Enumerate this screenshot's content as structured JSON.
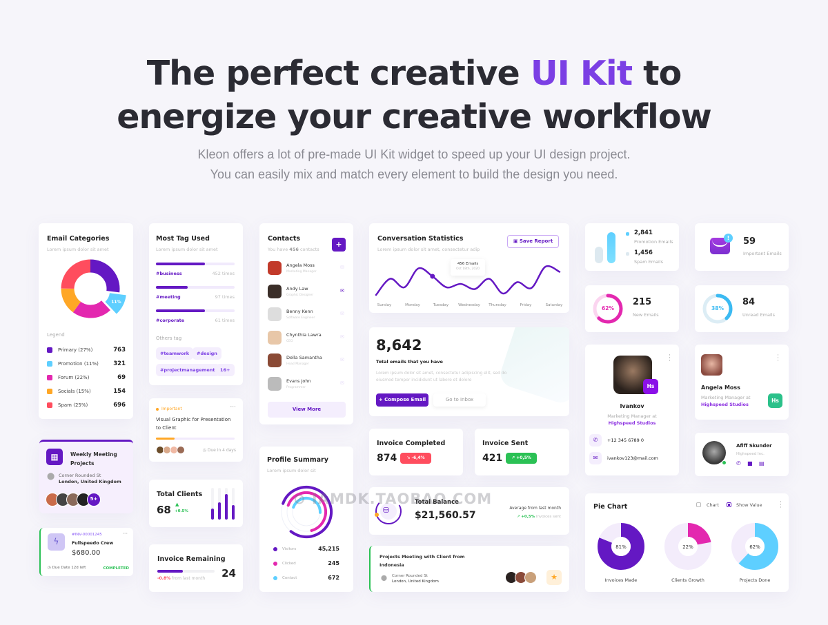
{
  "hero": {
    "line1_a": "The perfect creative ",
    "line1_accent": "UI Kit",
    "line1_b": " to",
    "line2": "energize your creative workflow",
    "sub1": "Kleon offers a lot of pre-made UI Kit widget to speed up your UI design project.",
    "sub2": "You can easily mix and match every element to build the design you need."
  },
  "colors": {
    "accent": "#6418c3",
    "cyan": "#5ecfff",
    "magenta": "#e328af",
    "orange": "#ffa726",
    "red": "#ff4d5e",
    "green": "#2bc155"
  },
  "email_categories": {
    "title": "Email Categories",
    "subtitle": "Lorem ipsum dolor sit amet",
    "legend_title": "Legend",
    "highlight": "11%",
    "items": [
      {
        "label": "Primary (27%)",
        "value": "763",
        "pct": 27,
        "color": "#6418c3"
      },
      {
        "label": "Promotion (11%)",
        "value": "321",
        "pct": 11,
        "color": "#5ecfff"
      },
      {
        "label": "Forum (22%)",
        "value": "69",
        "pct": 22,
        "color": "#e328af"
      },
      {
        "label": "Socials (15%)",
        "value": "154",
        "pct": 15,
        "color": "#ffa726"
      },
      {
        "label": "Spam (25%)",
        "value": "696",
        "pct": 25,
        "color": "#ff4d5e"
      }
    ]
  },
  "most_tag": {
    "title": "Most Tag Used",
    "subtitle": "Lorem ipsum dolor sit amet",
    "tags": [
      {
        "name": "#business",
        "count": "452 times",
        "fill": 0.62
      },
      {
        "name": "#meeting",
        "count": "97 times",
        "fill": 0.4
      },
      {
        "name": "#corporate",
        "count": "61 times",
        "fill": 0.62
      }
    ],
    "others_label": "Others tag",
    "others": [
      "#teamwork",
      "#design",
      "#projectmanagement",
      "16+"
    ]
  },
  "task": {
    "badge": "Important",
    "title": "Visual Graphic for Presentation to Client",
    "progress": 0.24,
    "due": "Due in 4 days"
  },
  "total_clients": {
    "title": "Total Clients",
    "value": "68",
    "change": "+0.5%",
    "bars": [
      0.35,
      0.55,
      0.8,
      0.45
    ]
  },
  "invoice_remaining": {
    "title": "Invoice Remaining",
    "value": "24",
    "change": "-0.8%",
    "change_text": " from last month",
    "progress": 0.45
  },
  "weekly_meeting": {
    "title": "Weekly Meeting Projects",
    "addr1": "Corner Rounded St",
    "addr2": "London, United Kingdom",
    "more": "5+"
  },
  "invoice": {
    "id": "#INV-00001245",
    "name": "Fullspeedo Crew",
    "amount": "$680.00",
    "due": "Due Date 12d left",
    "status": "COMPLETED"
  },
  "contacts": {
    "title": "Contacts",
    "subtitle_a": "You have ",
    "subtitle_count": "456",
    "subtitle_b": " contacts",
    "view_more": "View More",
    "items": [
      {
        "name": "Angela Moss",
        "role": "Marketing Manager"
      },
      {
        "name": "Andy Law",
        "role": "Graphic Designer"
      },
      {
        "name": "Benny Kenn",
        "role": "Software Engineer"
      },
      {
        "name": "Chynthia Lawra",
        "role": "CEO"
      },
      {
        "name": "Della Samantha",
        "role": "Head Manager"
      },
      {
        "name": "Evans John",
        "role": "Programmer"
      }
    ]
  },
  "profile_summary": {
    "title": "Profile Summary",
    "subtitle": "Lorem ipsum dolor sit",
    "items": [
      {
        "label": "Visitors",
        "value": "45,215",
        "color": "#6418c3",
        "fill": 0.8
      },
      {
        "label": "Clicked",
        "value": "245",
        "color": "#e328af",
        "fill": 0.65
      },
      {
        "label": "Contact",
        "value": "672",
        "color": "#5ecfff",
        "fill": 0.45
      }
    ]
  },
  "conversation": {
    "title": "Conversation Statistics",
    "subtitle": "Lorem ipsum dolor sit amet, consectetur adip",
    "save_label": "Save Report",
    "tooltip_value": "456 Emails",
    "tooltip_date": "Oct 18th, 2020",
    "chart_data": {
      "type": "line",
      "categories": [
        "Sunday",
        "Monday",
        "Tuesday",
        "Wednesday",
        "Thursday",
        "Friday",
        "Saturday"
      ],
      "values": [
        8,
        55,
        30,
        85,
        62,
        30,
        40,
        25,
        55,
        12,
        45,
        28,
        90,
        75
      ],
      "highlight_index": 4
    }
  },
  "total_emails": {
    "value": "8,642",
    "label": "Total emails that you have",
    "desc": "Lorem ipsum dolor sit amet, consectetur adipiscing elit, sed do eiusmod tempor incididunt ut labore et dolore",
    "compose": "+ Compose Email",
    "inbox": "Go to Inbox"
  },
  "invoice_completed": {
    "title": "Invoice Completed",
    "value": "874",
    "change": "-6,4%"
  },
  "invoice_sent": {
    "title": "Invoice Sent",
    "value": "421",
    "change": "+0,5%"
  },
  "balance": {
    "title": "Total Balance",
    "value": "$21,560.57",
    "avg_label": "Average from last month",
    "change": "+0,5%",
    "change_text": " invoices sent",
    "progress": 0.7
  },
  "project_meeting": {
    "title": "Projects Meeting with Client from Indonesia",
    "addr1": "Corner Rounded St",
    "addr2": "London, United Kingdom"
  },
  "promo": {
    "promo_value": "2,841",
    "promo_label": "Promotion Emails",
    "spam_value": "1,456",
    "spam_label": "Spam Emails"
  },
  "important": {
    "value": "59",
    "label": "Important Emails",
    "badge": "!"
  },
  "new_emails": {
    "pct": 62,
    "pct_label": "62%",
    "value": "215",
    "label": "New Emails"
  },
  "unread_emails": {
    "pct": 38,
    "pct_label": "38%",
    "value": "84",
    "label": "Unread Emails"
  },
  "ivankov": {
    "name": "Ivankov",
    "role": "Marketing Manager at",
    "company": "Highspeed Studios",
    "badge": "Hs",
    "phone": "+12 345 6789 0",
    "email": "ivankov123@mail.com"
  },
  "angela": {
    "name": "Angela Moss",
    "role": "Marketing Manager at",
    "company": "Highspeed Studios",
    "badge": "Hs"
  },
  "afiff": {
    "name": "Afiff Skunder",
    "company": "Highspeed Inc."
  },
  "pie": {
    "title": "Pie Chart",
    "chart_label": "Chart",
    "show_value_label": "Show Value",
    "chart_checked": false,
    "show_value_checked": true,
    "chart_data": {
      "type": "pie",
      "items": [
        {
          "label": "Invoices Made",
          "value": 81,
          "display": "81%",
          "color": "#6418c3"
        },
        {
          "label": "Clients Growth",
          "value": 22,
          "display": "22%",
          "color": "#e328af"
        },
        {
          "label": "Projects Done",
          "value": 62,
          "display": "62%",
          "color": "#5ecfff"
        }
      ]
    }
  },
  "watermark": "IAMDK.TAOBAO.COM"
}
